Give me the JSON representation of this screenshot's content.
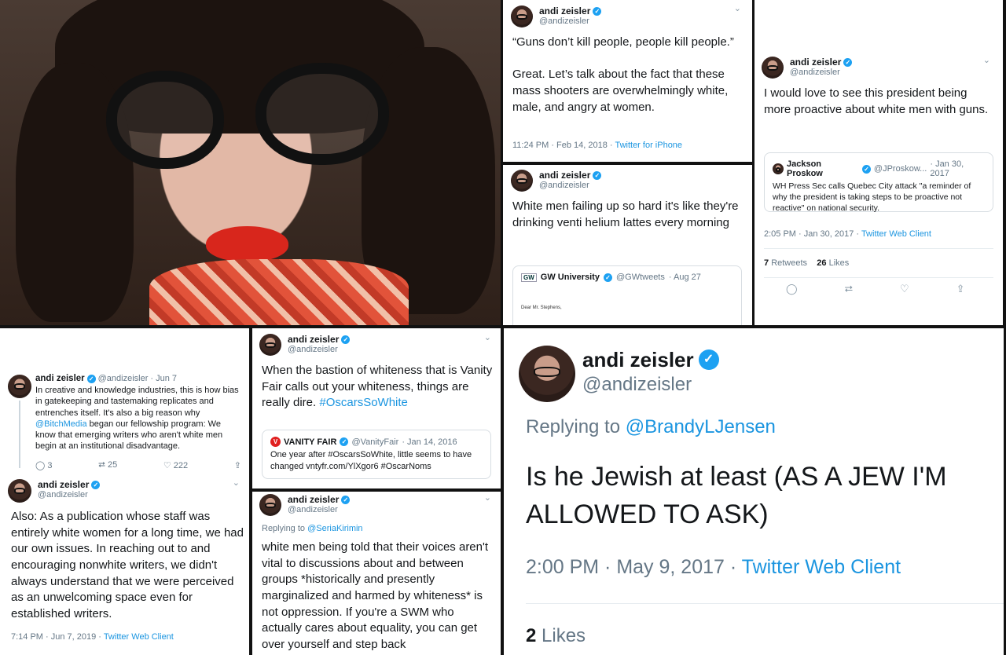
{
  "panel_top_middle": {
    "name": "andi zeisler",
    "handle": "@andizeisler",
    "text": "“Guns don’t kill people, people kill people.”\n\nGreat. Let’s talk about the fact that these mass shooters are overwhelmingly white, male, and angry at women.",
    "time": "11:24 PM · Feb 14, 2018",
    "client": "Twitter for iPhone"
  },
  "panel_top_right": {
    "name": "andi zeisler",
    "handle": "@andizeisler",
    "text": "I would love to see this president being more proactive about white men with guns.",
    "quote_name": "Jackson Proskow",
    "quote_handle": "@JProskow...",
    "quote_date": "· Jan 30, 2017",
    "quote_text": "WH Press Sec calls Quebec City attack \"a reminder of why the president is taking steps to be proactive not reactive\" on national security.",
    "time": "2:05 PM · Jan 30, 2017",
    "client": "Twitter Web Client",
    "retweets_num": "7",
    "retweets_label": "Retweets",
    "likes_num": "26",
    "likes_label": "Likes"
  },
  "panel_mid_middle": {
    "name": "andi zeisler",
    "handle": "@andizeisler",
    "text": "White men failing up so hard it's like they're drinking venti helium lattes every morning",
    "quote_name": "GW University",
    "quote_handle": "@GWtweets",
    "quote_date": "· Aug 27",
    "quote_text": "Dear Mr. Stephens,"
  },
  "panel_bottom_left": {
    "name": "andi zeisler",
    "handle": "@andizeisler",
    "date": "· Jun 7",
    "text_before": "In creative and knowledge industries, this is how bias in gatekeeping and tastemaking replicates and entrenches itself. It's also a big reason why ",
    "mention": "@BitchMedia",
    "text_after": " began our fellowship program: We know that emerging writers who aren't white men begin at an institutional disadvantage.",
    "replies": "3",
    "retweets": "25",
    "likes": "222",
    "name2": "andi zeisler",
    "handle2": "@andizeisler",
    "text2": "Also: As a publication whose staff was entirely white women for a long time, we had our own issues. In reaching out to and encouraging nonwhite writers, we didn't always understand that we were perceived as an unwelcoming space even for established writers.",
    "time2": "7:14 PM · Jun 7, 2019",
    "client2": "Twitter Web Client"
  },
  "panel_bottom_center_top": {
    "name": "andi zeisler",
    "handle": "@andizeisler",
    "text": "When the bastion of whiteness that is Vanity Fair calls out your whiteness, things are really dire. ",
    "hashtag": "#OscarsSoWhite",
    "quote_name": "VANITY FAIR",
    "quote_handle": "@VanityFair",
    "quote_date": "· Jan 14, 2016",
    "quote_text": "One year after #OscarsSoWhite, little seems to have changed vntyfr.com/YlXgor6 #OscarNoms"
  },
  "panel_bottom_center_bottom": {
    "name": "andi zeisler",
    "handle": "@andizeisler",
    "replying_label": "Replying to ",
    "replying_to": "@SeriaKirimin",
    "text": "white men being told that their voices aren't vital to discussions about and between groups *historically and presently marginalized and harmed by whiteness* is not oppression. If you're a SWM who actually cares about equality, you can get over yourself and step back"
  },
  "panel_bottom_right": {
    "name": "andi zeisler",
    "handle": "@andizeisler",
    "replying_label": "Replying to ",
    "replying_to": "@BrandyLJensen",
    "text": "Is he Jewish at least (AS A JEW I'M ALLOWED TO ASK)",
    "time": "2:00 PM · May 9, 2017",
    "client": "Twitter Web Client",
    "likes_num": "2",
    "likes_label": "Likes"
  },
  "icons": {
    "verified": "✓",
    "chevron": "⌄",
    "reply": "◯",
    "retweet": "⮂",
    "like": "♡",
    "share": "⇪"
  },
  "colors": {
    "accent": "#1da1f2",
    "link": "#1b95e0",
    "muted": "#657786"
  }
}
